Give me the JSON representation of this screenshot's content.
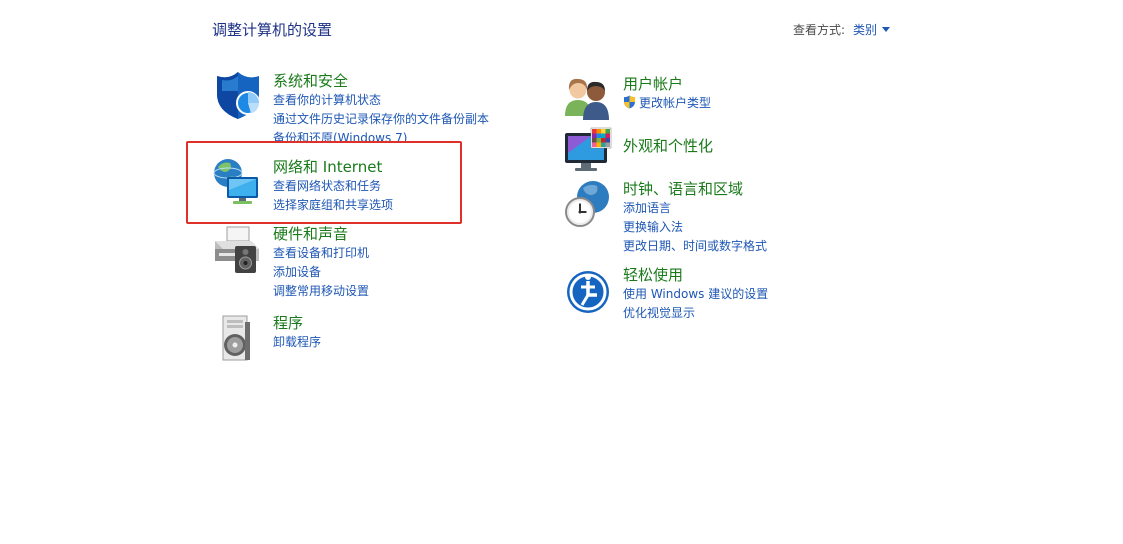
{
  "header": {
    "title": "调整计算机的设置",
    "view_by_label": "查看方式:",
    "view_by_value": "类别"
  },
  "categories": [
    {
      "title": "系统和安全",
      "links": [
        "查看你的计算机状态",
        "通过文件历史记录保存你的文件备份副本",
        "备份和还原(Windows 7)"
      ],
      "icon": "shield-icon"
    },
    {
      "title": "网络和 Internet",
      "links": [
        "查看网络状态和任务",
        "选择家庭组和共享选项"
      ],
      "icon": "network-globe-icon"
    },
    {
      "title": "硬件和声音",
      "links": [
        "查看设备和打印机",
        "添加设备",
        "调整常用移动设置"
      ],
      "icon": "printer-icon"
    },
    {
      "title": "程序",
      "links": [
        "卸载程序"
      ],
      "icon": "programs-disc-icon"
    },
    {
      "title": "用户帐户",
      "links": [
        "更改帐户类型"
      ],
      "icon": "users-icon"
    },
    {
      "title": "外观和个性化",
      "links": [],
      "icon": "monitor-palette-icon"
    },
    {
      "title": "时钟、语言和区域",
      "links": [
        "添加语言",
        "更换输入法",
        "更改日期、时间或数字格式"
      ],
      "icon": "clock-globe-icon"
    },
    {
      "title": "轻松使用",
      "links": [
        "使用 Windows 建议的设置",
        "优化视觉显示"
      ],
      "icon": "ease-of-access-icon"
    }
  ],
  "colors": {
    "title_green": "#1a7a1a",
    "link_blue": "#1e57b4",
    "highlight_red": "#e0302a"
  }
}
